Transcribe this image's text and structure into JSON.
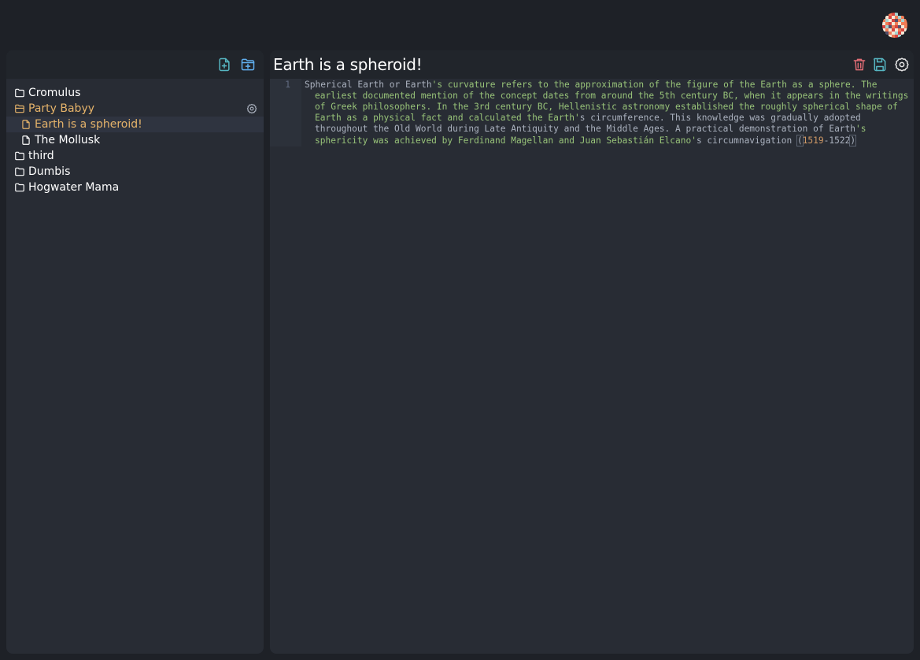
{
  "header": {
    "avatar": {
      "label": "user-avatar",
      "pixels": [
        "#1e2127",
        "#1e2127",
        "#f07c56",
        "#d8453f",
        "#a8d3cf",
        "#1e2127",
        "#1e2127",
        "#1e2127",
        "#1e2127",
        "#f5e8d6",
        "#d8453f",
        "#f5e8d6",
        "#f07c56",
        "#a8d3cf",
        "#f07c56",
        "#1e2127",
        "#f07c56",
        "#a8d3cf",
        "#f5e8d6",
        "#d8453f",
        "#56506a",
        "#f07c56",
        "#a8d3cf",
        "#f07c56",
        "#f5e8d6",
        "#f07c56",
        "#d8453f",
        "#f5e8d6",
        "#f07c56",
        "#f5e8d6",
        "#f07c56",
        "#f07c56",
        "#d8453f",
        "#a8d3cf",
        "#56506a",
        "#f07c56",
        "#d8453f",
        "#56506a",
        "#f5e8d6",
        "#f07c56",
        "#f5e8d6",
        "#f07c56",
        "#f5e8d6",
        "#d8453f",
        "#f5e8d6",
        "#f07c56",
        "#d8453f",
        "#f5e8d6",
        "#1e2127",
        "#56506a",
        "#f07c56",
        "#f5e8d6",
        "#a8d3cf",
        "#d8453f",
        "#f5e8d6",
        "#1e2127",
        "#1e2127",
        "#1e2127",
        "#f5e8d6",
        "#f07c56",
        "#d8453f",
        "#a8d3cf",
        "#1e2127",
        "#1e2127"
      ]
    }
  },
  "sidebar": {
    "actions": {
      "new_file_icon": "file-plus-icon",
      "new_folder_icon": "folder-plus-icon"
    },
    "tree": [
      {
        "type": "folder",
        "label": "Cromulus",
        "open": false,
        "level": 0
      },
      {
        "type": "folder",
        "label": "Party Babyy",
        "open": true,
        "level": 0,
        "has_settings": true
      },
      {
        "type": "file",
        "label": "Earth is a spheroid!",
        "level": 1,
        "selected": true
      },
      {
        "type": "file",
        "label": "The Mollusk",
        "level": 1
      },
      {
        "type": "folder",
        "label": "third",
        "open": false,
        "level": 0
      },
      {
        "type": "folder",
        "label": "Dumbis",
        "open": false,
        "level": 0
      },
      {
        "type": "folder",
        "label": "Hogwater Mama",
        "open": false,
        "level": 0
      }
    ]
  },
  "editor": {
    "title": "Earth is a spheroid!",
    "actions": {
      "delete_icon": "trash-icon",
      "save_icon": "save-icon",
      "settings_icon": "gear-icon"
    },
    "line_number": "1",
    "tokens": [
      {
        "t": "plain",
        "v": "Spherical Earth or Earth"
      },
      {
        "t": "str",
        "v": "'s curvature refers to the approximation of the figure of the Earth as a sphere. The earliest documented mention of the concept dates from around the 5th century BC, when it appears in the writings of Greek philosophers. In the 3rd century BC, Hellenistic astronomy established the roughly spherical shape of Earth as a physical fact and calculated the Earth'"
      },
      {
        "t": "plain",
        "v": "s circumference. This knowledge was gradually adopted throughout the Old World during Late Antiquity and the Middle Ages. A practical demonstration of Earth"
      },
      {
        "t": "str",
        "v": "'s sphericity was achieved by Ferdinand Magellan and Juan Sebastián Elcano'"
      },
      {
        "t": "plain",
        "v": "s circumnavigation "
      },
      {
        "t": "bracket",
        "v": "("
      },
      {
        "t": "num",
        "v": "1519"
      },
      {
        "t": "plain",
        "v": "-1522"
      },
      {
        "t": "bracket",
        "v": ")"
      }
    ]
  },
  "colors": {
    "accent": "#61afef",
    "active": "#e5b36a",
    "danger": "#e06c75",
    "string": "#98c379",
    "number": "#d19a66"
  }
}
